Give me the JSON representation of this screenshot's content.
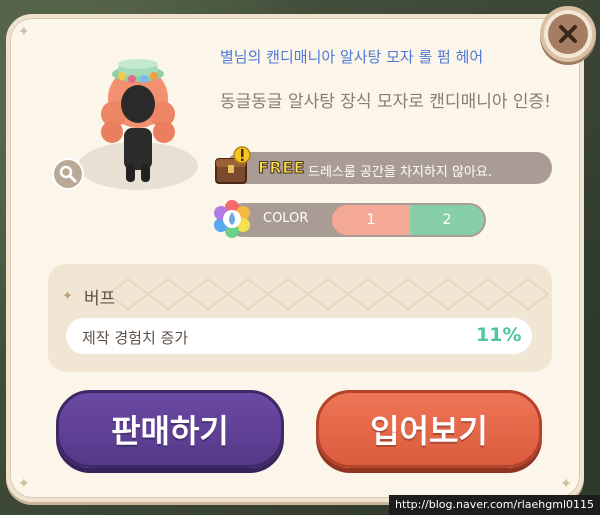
{
  "item": {
    "title": "별님의 캔디매니아 알사탕 모자 롤 펌 헤어",
    "description": "동글동글 알사탕 장식 모자로 캔디매니아 인증!"
  },
  "free": {
    "tag": "FREE",
    "text": "드레스룸 공간을 차지하지 않아요."
  },
  "color": {
    "label": "COLOR",
    "options": [
      "1",
      "2"
    ],
    "colors": [
      "#f4a996",
      "#87cfa8"
    ]
  },
  "buff": {
    "title": "버프",
    "name": "제작 경험치 증가",
    "value": "11%"
  },
  "buttons": {
    "sell": "판매하기",
    "try_on": "입어보기"
  },
  "watermark": "http://blog.naver.com/rlaehgml0115",
  "icons": {
    "close": "close-icon",
    "magnify": "magnifier-icon",
    "chest": "treasure-chest-icon",
    "palette": "color-flower-icon",
    "buff": "sparkle-icon"
  }
}
